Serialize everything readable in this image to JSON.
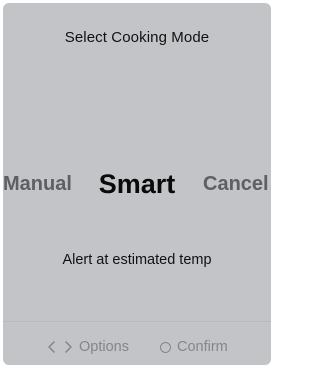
{
  "screen": {
    "title": "Select Cooking Mode",
    "modes": {
      "previous": "Manual",
      "selected": "Smart",
      "next": "Cancel"
    },
    "description": "Alert at estimated temp",
    "footer": {
      "options_label": "Options",
      "confirm_label": "Confirm"
    }
  },
  "colors": {
    "background": "#c3c4c8",
    "primary_text": "#111111",
    "inactive_text": "#5e5f63",
    "footer_text": "#85868a"
  },
  "icons": {
    "options": [
      "chevron-left-icon",
      "chevron-right-icon"
    ],
    "confirm": "circle-icon"
  }
}
